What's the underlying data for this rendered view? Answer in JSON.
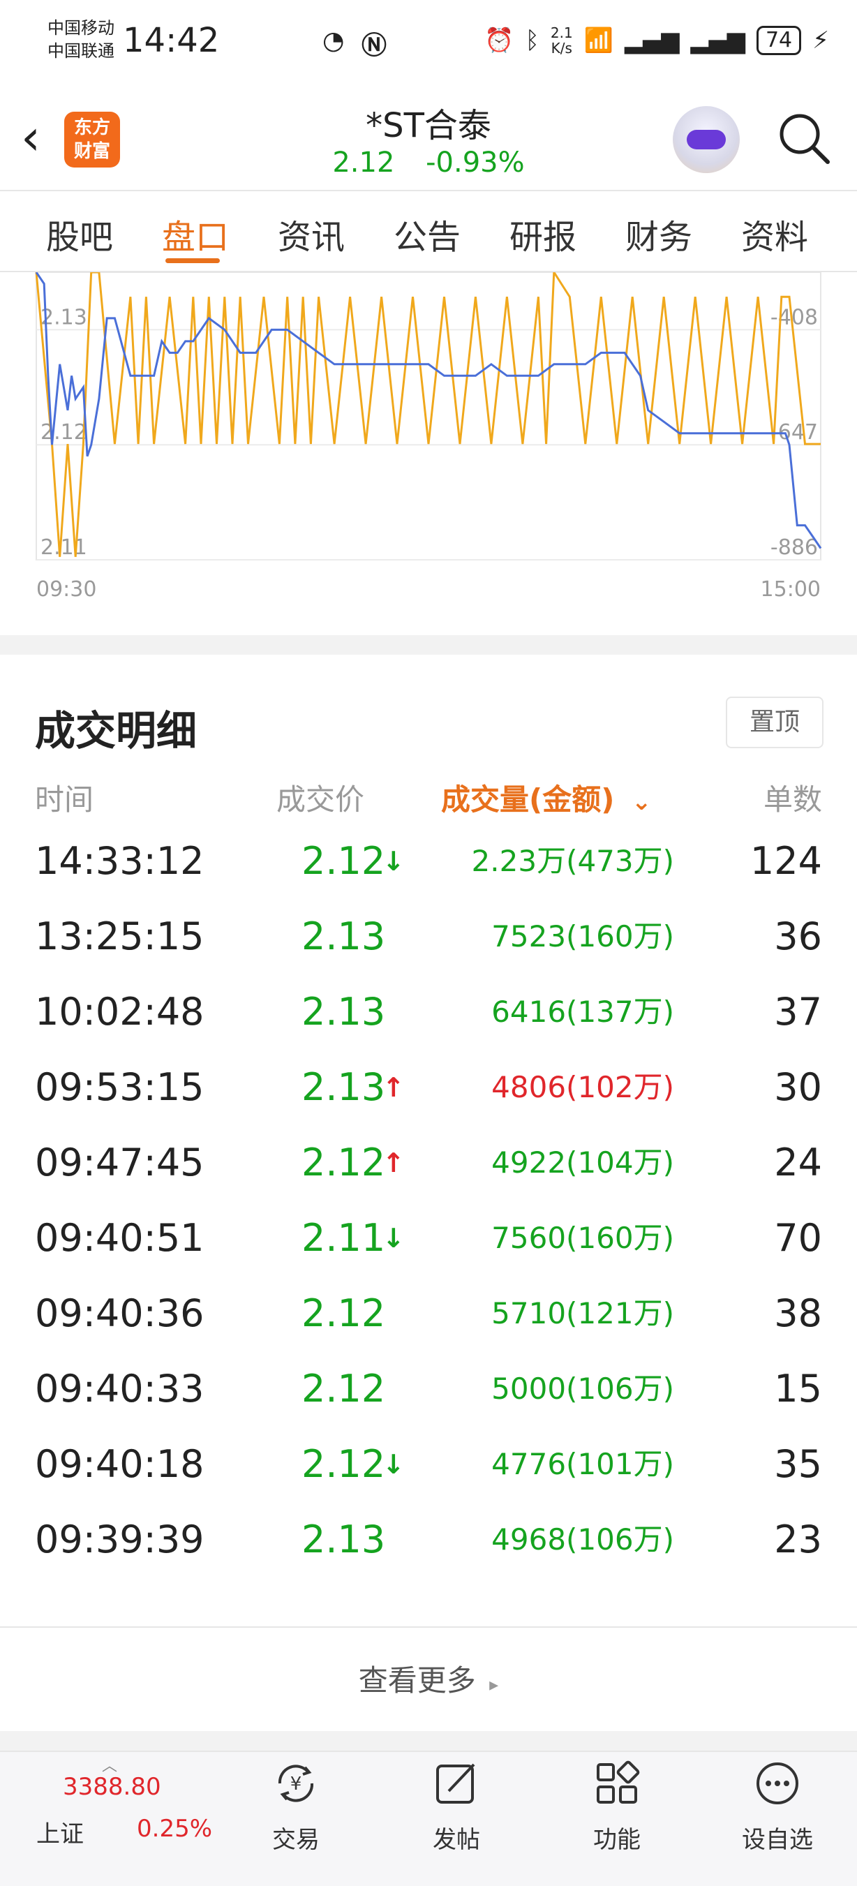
{
  "status_bar": {
    "carrier1": "中国移动",
    "carrier2": "中国联通",
    "time": "14:42",
    "net_speed_value": "2.1",
    "net_speed_unit": "K/s",
    "battery": "74"
  },
  "header": {
    "logo_line1": "东方",
    "logo_line2": "财富",
    "stock_name": "*ST合泰",
    "price": "2.12",
    "change_pct": "-0.93%"
  },
  "tabs": [
    "股吧",
    "盘口",
    "资讯",
    "公告",
    "研报",
    "财务",
    "资料"
  ],
  "active_tab": "盘口",
  "chart_data": {
    "type": "line",
    "y_left_ticks": [
      "2.13",
      "2.12",
      "2.11"
    ],
    "y_right_ticks": [
      "-408",
      "-647",
      "-886"
    ],
    "x_labels": [
      "09:30",
      "15:00"
    ],
    "series": [
      {
        "color": "#4a6fd8",
        "axis": "left",
        "x": [
          0,
          0.01,
          0.015,
          0.02,
          0.03,
          0.04,
          0.045,
          0.05,
          0.06,
          0.065,
          0.07,
          0.08,
          0.09,
          0.1,
          0.12,
          0.13,
          0.15,
          0.16,
          0.17,
          0.18,
          0.19,
          0.2,
          0.22,
          0.24,
          0.26,
          0.28,
          0.3,
          0.32,
          0.34,
          0.36,
          0.38,
          0.4,
          0.42,
          0.44,
          0.46,
          0.48,
          0.5,
          0.52,
          0.54,
          0.56,
          0.58,
          0.6,
          0.62,
          0.64,
          0.66,
          0.68,
          0.7,
          0.72,
          0.74,
          0.75,
          0.77,
          0.78,
          0.8,
          0.82,
          0.84,
          0.86,
          0.88,
          0.9,
          0.92,
          0.94,
          0.955,
          0.96,
          0.97,
          0.98,
          0.99,
          1.0
        ],
        "y": [
          2.135,
          2.134,
          2.126,
          2.12,
          2.127,
          2.123,
          2.126,
          2.124,
          2.125,
          2.119,
          2.12,
          2.124,
          2.131,
          2.131,
          2.126,
          2.126,
          2.126,
          2.129,
          2.128,
          2.128,
          2.129,
          2.129,
          2.131,
          2.13,
          2.128,
          2.128,
          2.13,
          2.13,
          2.129,
          2.128,
          2.127,
          2.127,
          2.127,
          2.127,
          2.127,
          2.127,
          2.127,
          2.126,
          2.126,
          2.126,
          2.127,
          2.126,
          2.126,
          2.126,
          2.127,
          2.127,
          2.127,
          2.128,
          2.128,
          2.128,
          2.126,
          2.123,
          2.122,
          2.121,
          2.121,
          2.121,
          2.121,
          2.121,
          2.121,
          2.121,
          2.121,
          2.12,
          2.113,
          2.113,
          2.112,
          2.111
        ]
      },
      {
        "color": "#f0a81c",
        "axis": "right",
        "x": [
          0,
          0.02,
          0.03,
          0.04,
          0.05,
          0.06,
          0.07,
          0.08,
          0.1,
          0.12,
          0.13,
          0.14,
          0.15,
          0.17,
          0.19,
          0.2,
          0.21,
          0.22,
          0.23,
          0.24,
          0.25,
          0.26,
          0.27,
          0.29,
          0.31,
          0.32,
          0.33,
          0.34,
          0.35,
          0.36,
          0.38,
          0.4,
          0.42,
          0.44,
          0.46,
          0.48,
          0.5,
          0.52,
          0.54,
          0.56,
          0.58,
          0.6,
          0.62,
          0.64,
          0.65,
          0.66,
          0.68,
          0.7,
          0.72,
          0.74,
          0.76,
          0.78,
          0.8,
          0.82,
          0.84,
          0.86,
          0.88,
          0.9,
          0.92,
          0.94,
          0.95,
          0.96,
          0.98,
          1.0
        ],
        "y": [
          -300,
          -650,
          -880,
          -650,
          -880,
          -650,
          -300,
          -300,
          -650,
          -350,
          -650,
          -350,
          -650,
          -350,
          -650,
          -350,
          -650,
          -350,
          -650,
          -350,
          -650,
          -350,
          -650,
          -350,
          -650,
          -350,
          -650,
          -350,
          -650,
          -350,
          -650,
          -350,
          -650,
          -350,
          -650,
          -350,
          -650,
          -350,
          -650,
          -350,
          -650,
          -350,
          -650,
          -350,
          -650,
          -300,
          -350,
          -650,
          -350,
          -650,
          -350,
          -650,
          -350,
          -650,
          -350,
          -650,
          -350,
          -650,
          -350,
          -650,
          -350,
          -350,
          -650,
          -650
        ]
      }
    ]
  },
  "detail": {
    "title": "成交明细",
    "pin_label": "置顶",
    "columns": {
      "time": "时间",
      "price": "成交价",
      "volume": "成交量(金额)",
      "count": "单数"
    },
    "rows": [
      {
        "time": "14:33:12",
        "price": "2.12",
        "arrow": "↓",
        "volume": "2.23万(473万)",
        "count": "124"
      },
      {
        "time": "13:25:15",
        "price": "2.13",
        "arrow": "",
        "volume": "7523(160万)",
        "count": "36"
      },
      {
        "time": "10:02:48",
        "price": "2.13",
        "arrow": "",
        "volume": "6416(137万)",
        "count": "37"
      },
      {
        "time": "09:53:15",
        "price": "2.13",
        "arrow": "↑",
        "volume": "4806(102万)",
        "count": "30"
      },
      {
        "time": "09:47:45",
        "price": "2.12",
        "arrow": "↑",
        "volume": "4922(104万)",
        "count": "24"
      },
      {
        "time": "09:40:51",
        "price": "2.11",
        "arrow": "↓",
        "volume": "7560(160万)",
        "count": "70"
      },
      {
        "time": "09:40:36",
        "price": "2.12",
        "arrow": "",
        "volume": "5710(121万)",
        "count": "38"
      },
      {
        "time": "09:40:33",
        "price": "2.12",
        "arrow": "",
        "volume": "5000(106万)",
        "count": "15"
      },
      {
        "time": "09:40:18",
        "price": "2.12",
        "arrow": "↓",
        "volume": "4776(101万)",
        "count": "35"
      },
      {
        "time": "09:39:39",
        "price": "2.13",
        "arrow": "",
        "volume": "4968(106万)",
        "count": "23"
      }
    ],
    "more_label": "查看更多"
  },
  "bottom_nav": {
    "index_value": "3388.80",
    "index_name": "上证",
    "index_pct": "0.25%",
    "items": [
      {
        "label": "交易",
        "icon": "trade-icon"
      },
      {
        "label": "发帖",
        "icon": "post-icon"
      },
      {
        "label": "功能",
        "icon": "functions-icon"
      },
      {
        "label": "设自选",
        "icon": "more-icon"
      }
    ]
  },
  "colors": {
    "accent": "#e8701c",
    "green": "#15a31f",
    "red": "#e0262b",
    "line_blue": "#4a6fd8",
    "line_orange": "#f0a81c"
  }
}
